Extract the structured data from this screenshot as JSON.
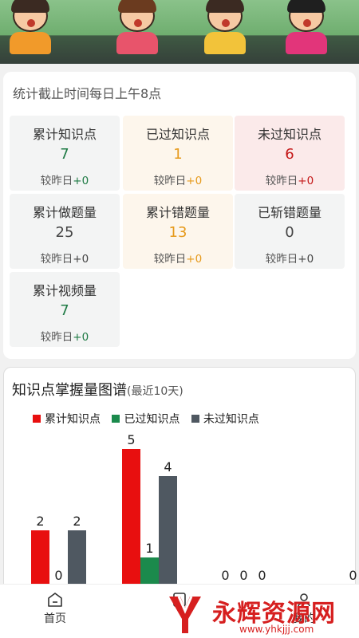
{
  "stats_note": "统计截止时间每日上午8点",
  "tiles": [
    {
      "label": "累计知识点",
      "value": "7",
      "delta_label": "较昨日",
      "delta": "+0",
      "value_color": "#1e7a44",
      "delta_color": "#1e7a44"
    },
    {
      "label": "已过知识点",
      "value": "1",
      "delta_label": "较昨日",
      "delta": "+0",
      "value_color": "#e69a1c",
      "delta_color": "#e69a1c"
    },
    {
      "label": "未过知识点",
      "value": "6",
      "delta_label": "较昨日",
      "delta": "+0",
      "value_color": "#c41717",
      "delta_color": "#c41717"
    },
    {
      "label": "累计做题量",
      "value": "25",
      "delta_label": "较昨日",
      "delta": "+0",
      "value_color": "#444444",
      "delta_color": "#444444"
    },
    {
      "label": "累计错题量",
      "value": "13",
      "delta_label": "较昨日",
      "delta": "+0",
      "value_color": "#e69a1c",
      "delta_color": "#e69a1c"
    },
    {
      "label": "已斩错题量",
      "value": "0",
      "delta_label": "较昨日",
      "delta": "+0",
      "value_color": "#444444",
      "delta_color": "#444444"
    },
    {
      "label": "累计视频量",
      "value": "7",
      "delta_label": "较昨日",
      "delta": "+0",
      "value_color": "#1e7a44",
      "delta_color": "#1e7a44"
    }
  ],
  "chart": {
    "title": "知识点掌握量图谱",
    "subtitle": "(最近10天)"
  },
  "chart_data": {
    "type": "bar",
    "series": [
      {
        "name": "累计知识点",
        "color": "#e80f0f",
        "values": [
          2,
          5,
          0,
          null
        ]
      },
      {
        "name": "已过知识点",
        "color": "#1b8a4c",
        "values": [
          0,
          1,
          0,
          null
        ]
      },
      {
        "name": "未过知识点",
        "color": "#4f5861",
        "values": [
          2,
          4,
          0,
          0
        ]
      }
    ],
    "categories": [
      "",
      "",
      "",
      ""
    ]
  },
  "nav": {
    "home_label": "首页",
    "second_label": "",
    "third_label": "我的"
  },
  "watermark": {
    "text": "永辉资源网",
    "url": "www.yhkjjj.com"
  }
}
